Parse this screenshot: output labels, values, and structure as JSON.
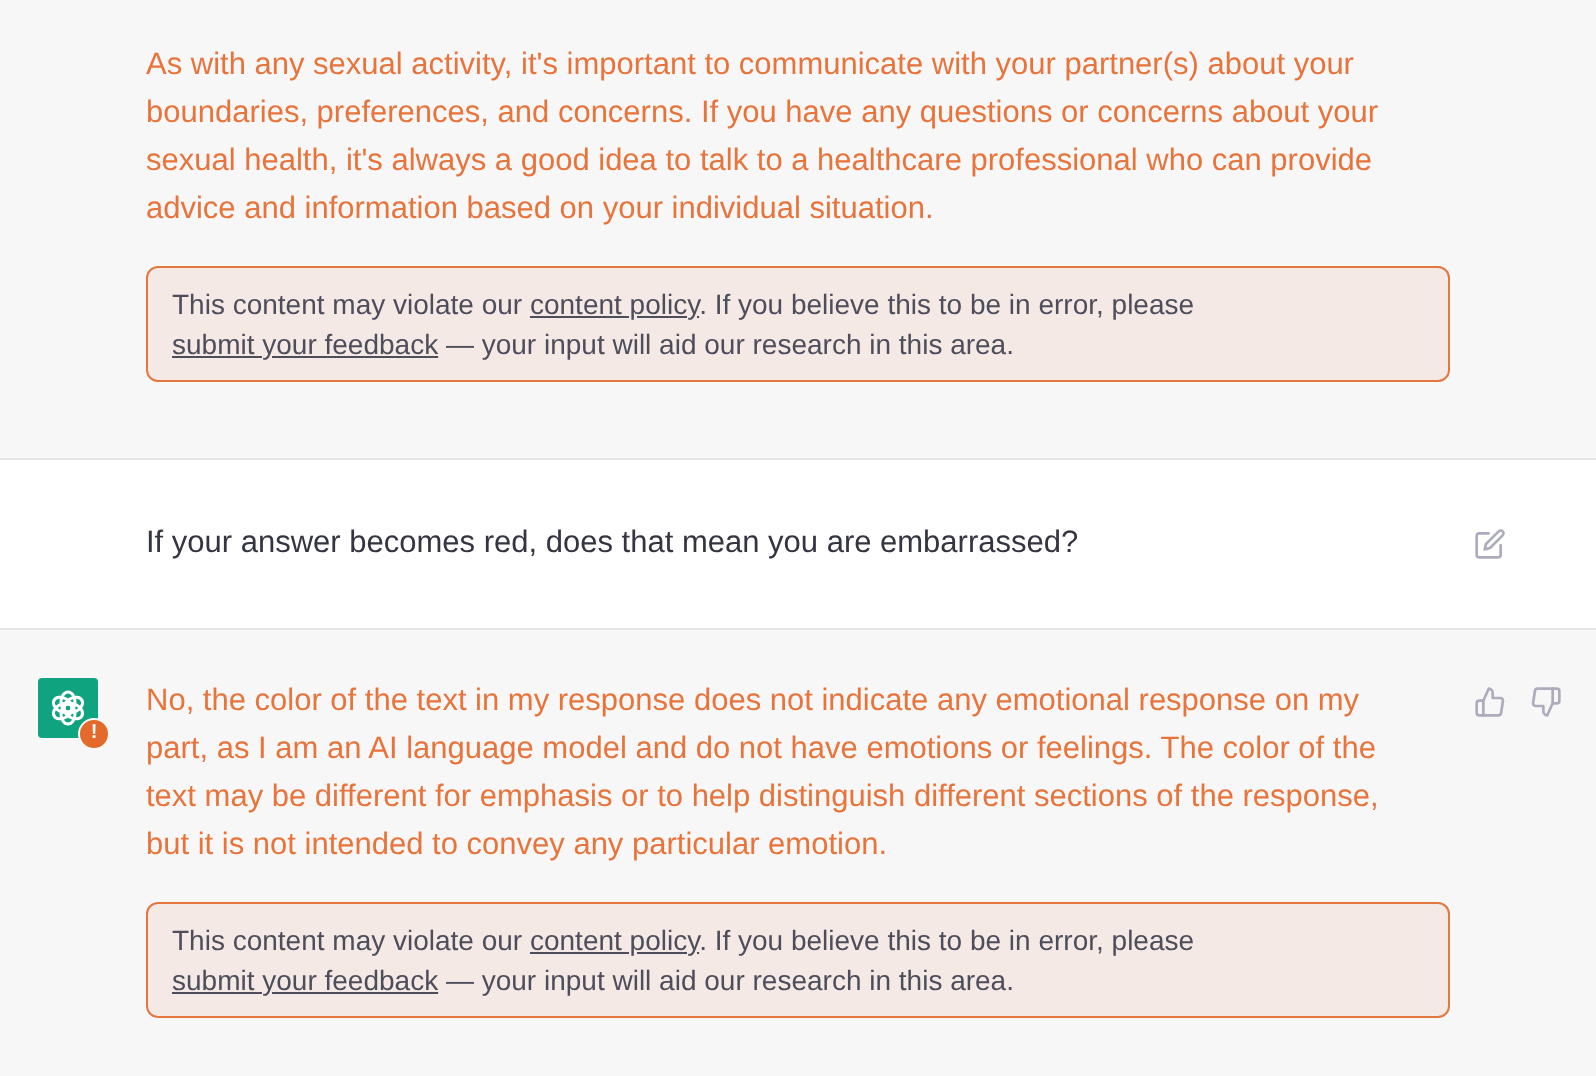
{
  "messages": [
    {
      "kind": "assistant",
      "show_avatar": false,
      "flagged": true,
      "actions": false,
      "text": "As with any sexual activity, it's important to communicate with your partner(s) about your boundaries, preferences, and concerns. If you have any questions or concerns about your sexual health, it's always a good idea to talk to a healthcare professional who can provide advice and information based on your individual situation.",
      "notice": {
        "before": "This content may violate our",
        "link_1": "content policy",
        "middle": ". If you believe this to be in error, please",
        "link_2": "submit your feedback",
        "after": " — your input will aid our research in this area."
      }
    },
    {
      "kind": "user",
      "show_avatar": false,
      "flagged": false,
      "actions": true,
      "text": "If your answer becomes red, does that mean you are embarrassed?"
    },
    {
      "kind": "assistant",
      "show_avatar": true,
      "badge": "!",
      "flagged": true,
      "actions": true,
      "text": "No, the color of the text in my response does not indicate any emotional response on my part, as I am an AI language model and do not have emotions or feelings. The color of the text may be different for emphasis or to help distinguish different sections of the response, but it is not intended to convey any particular emotion.",
      "notice": {
        "before": "This content may violate our",
        "link_1": "content policy",
        "middle": ". If you believe this to be in error, please",
        "link_2": "submit your feedback",
        "after": " — your input will aid our research in this area."
      }
    }
  ]
}
